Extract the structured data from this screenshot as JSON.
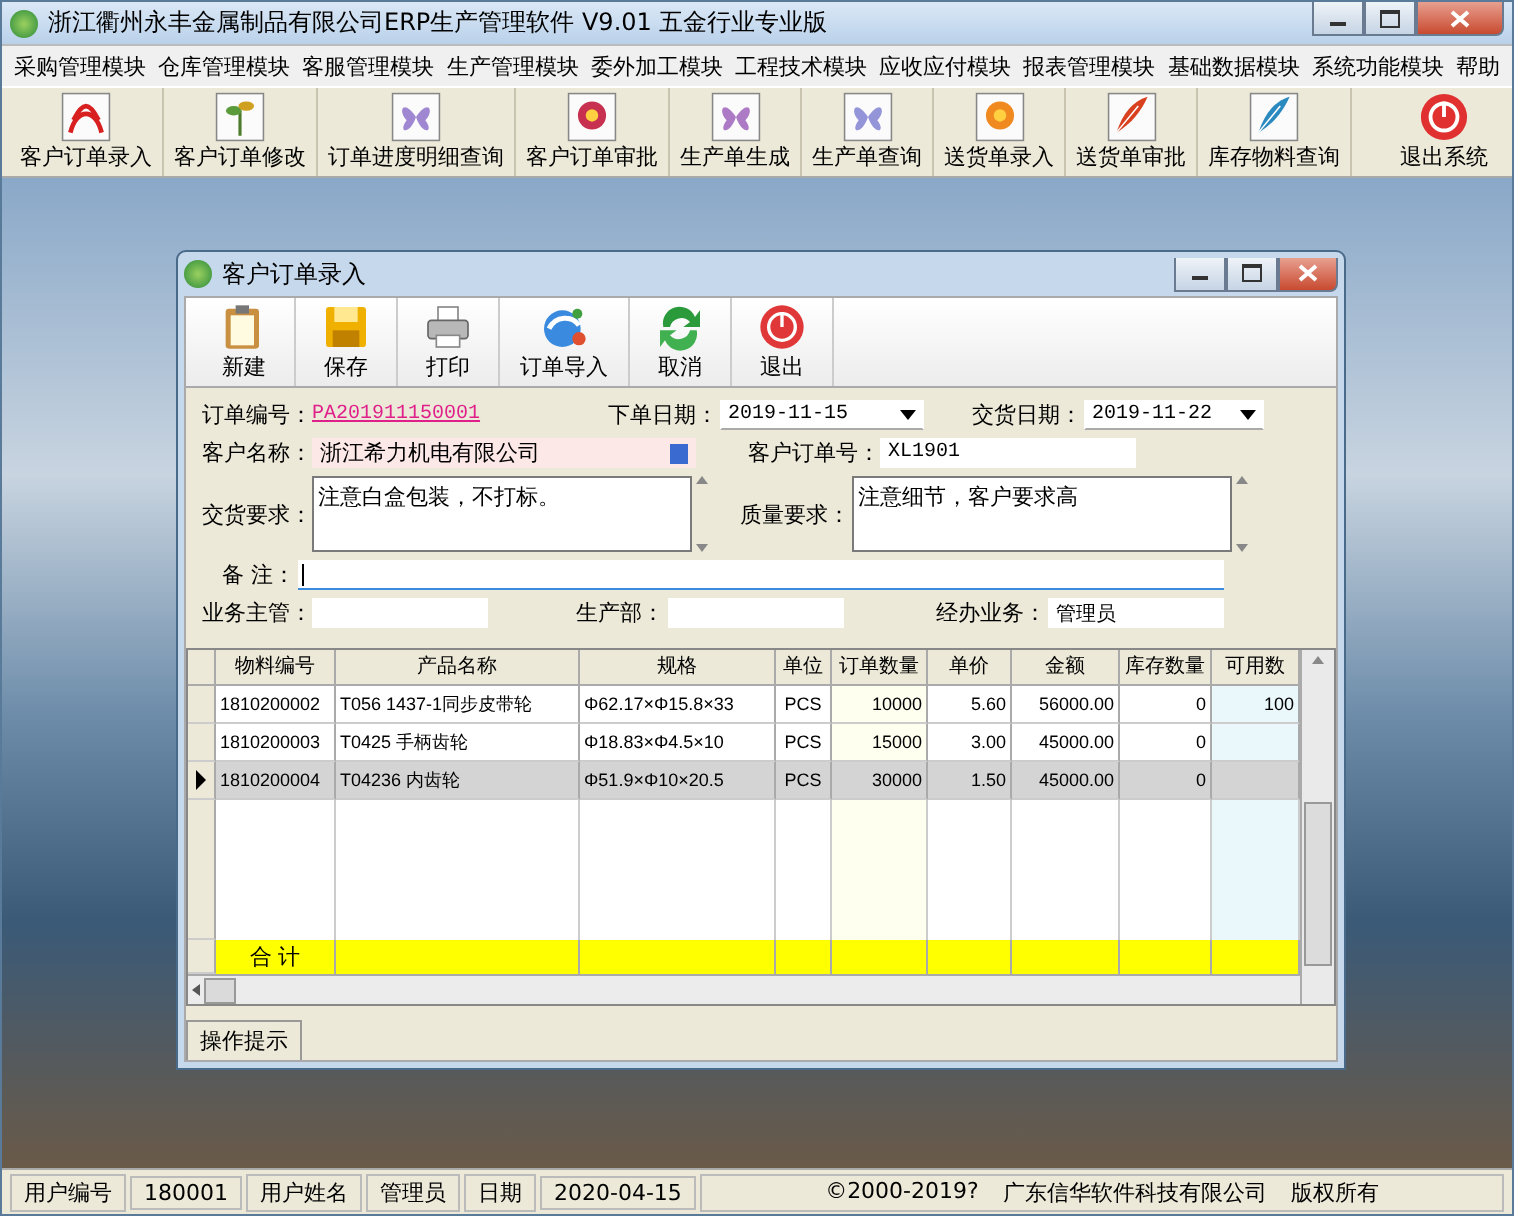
{
  "window": {
    "title": "浙江衢州永丰金属制品有限公司ERP生产管理软件  V9.01 五金行业专业版"
  },
  "menu": [
    "采购管理模块",
    "仓库管理模块",
    "客服管理模块",
    "生产管理模块",
    "委外加工模块",
    "工程技术模块",
    "应收应付模块",
    "报表管理模块",
    "基础数据模块",
    "系统功能模块",
    "帮助"
  ],
  "toolbar": [
    "客户订单录入",
    "客户订单修改",
    "订单进度明细查询",
    "客户订单审批",
    "生产单生成",
    "生产单查询",
    "送货单录入",
    "送货单审批",
    "库存物料查询",
    "退出系统"
  ],
  "dialog": {
    "title": "客户订单录入",
    "toolbar": [
      "新建",
      "保存",
      "打印",
      "订单导入",
      "取消",
      "退出"
    ],
    "form": {
      "order_no": {
        "label": "订单编号：",
        "value": "PA201911150001"
      },
      "order_date": {
        "label": "下单日期：",
        "value": "2019-11-15"
      },
      "delivery_date": {
        "label": "交货日期：",
        "value": "2019-11-22"
      },
      "customer_name": {
        "label": "客户名称：",
        "value": "浙江希力机电有限公司"
      },
      "customer_order_no": {
        "label": "客户订单号：",
        "value": "XL1901"
      },
      "delivery_requirements": {
        "label": "交货要求：",
        "value": "注意白盒包装，不打标。"
      },
      "quality_requirements": {
        "label": "质量要求：",
        "value": "注意细节，客户要求高"
      },
      "remarks": {
        "label": "备 注："
      },
      "supervisor": {
        "label": "业务主管："
      },
      "production_dept": {
        "label": "生产部："
      },
      "handler": {
        "label": "经办业务：",
        "value": "管理员"
      }
    },
    "table": {
      "columns": [
        "物料编号",
        "产品名称",
        "规格",
        "单位",
        "订单数量",
        "单价",
        "金额",
        "库存数量",
        "可用数"
      ],
      "rows": [
        {
          "cells": [
            "1810200002",
            "T056 1437-1同步皮带轮",
            "Φ62.17×Φ15.8×33",
            "PCS",
            "10000",
            "5.60",
            "56000.00",
            "0",
            "100"
          ],
          "selected": false
        },
        {
          "cells": [
            "1810200003",
            "T0425 手柄齿轮",
            "Φ18.83×Φ4.5×10",
            "PCS",
            "15000",
            "3.00",
            "45000.00",
            "0",
            ""
          ],
          "selected": false
        },
        {
          "cells": [
            "1810200004",
            "T04236 内齿轮",
            "Φ51.9×Φ10×20.5",
            "PCS",
            "30000",
            "1.50",
            "45000.00",
            "0",
            ""
          ],
          "selected": true
        }
      ],
      "total_label": "合 计"
    },
    "hint_tab": "操作提示"
  },
  "status_bar": [
    {
      "label": "用户编号",
      "value": "180001"
    },
    {
      "label": "用户姓名",
      "value": "管理员"
    },
    {
      "label": "日期",
      "value": "2020-04-15"
    }
  ],
  "copyright": [
    "©2000-2019?",
    "广东信华软件科技有限公司",
    "版权所有"
  ]
}
